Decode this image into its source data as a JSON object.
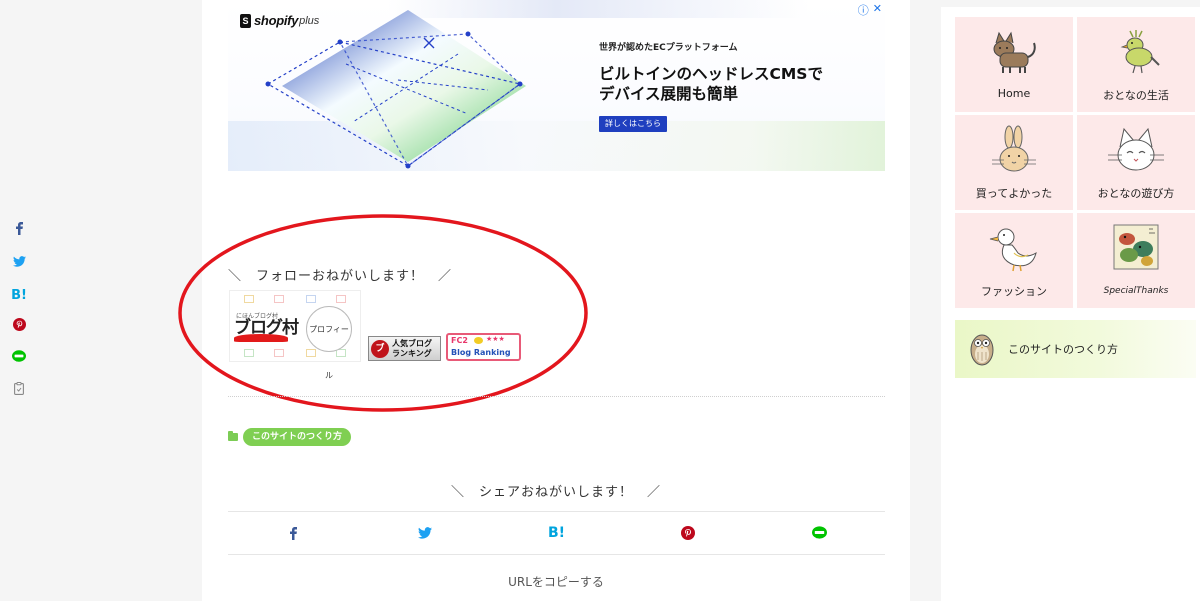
{
  "side_share": {
    "icons": [
      "facebook-icon",
      "twitter-icon",
      "hatena-bookmark-icon",
      "pinterest-icon",
      "line-icon",
      "copy-icon"
    ],
    "hatena_label": "B!",
    "colors": {
      "facebook": "#3b5998",
      "twitter": "#1da1f2",
      "hatena": "#00a4de",
      "pinterest": "#bd081c",
      "line": "#00c300",
      "copy": "#888888"
    }
  },
  "ad": {
    "logo_brand": "shopify",
    "logo_plus": "plus",
    "kicker": "世界が認めたECプラットフォーム",
    "headline_line1": "ビルトインのヘッドレスCMSで",
    "headline_line2": "デバイス展開も簡単",
    "cta": "詳しくはこちら",
    "info_icon": "ⓘ",
    "close_icon": "✕"
  },
  "follow": {
    "heading_left": "＼",
    "heading": "フォローおねがいします！",
    "heading_right": "／",
    "blogmura": {
      "small": "にほんブログ村",
      "main": "ブログ村",
      "circle": "プロフィール"
    },
    "ninki": {
      "line1": "人気ブログ",
      "line2": "ランキング"
    },
    "fc2": {
      "line1": "FC2",
      "stars": "★★★",
      "line2": "Blog Ranking"
    }
  },
  "category": {
    "label": "このサイトのつくり方",
    "accent": "#7fcf52"
  },
  "share": {
    "heading_left": "＼",
    "heading": "シェアおねがいします！",
    "heading_right": "／",
    "hatena_label": "B!",
    "copy_url": "URLをコピーする"
  },
  "sidebar": {
    "menu": [
      {
        "label": "Home",
        "icon": "cat-icon"
      },
      {
        "label": "おとなの生活",
        "icon": "bird-icon"
      },
      {
        "label": "買ってよかった",
        "icon": "rabbit-icon"
      },
      {
        "label": "おとなの遊び方",
        "icon": "cat-face-icon"
      },
      {
        "label": "ファッション",
        "icon": "duck-icon"
      },
      {
        "label": "SpecialThanks",
        "icon": "birds-painting-icon"
      }
    ],
    "howto": {
      "label": "このサイトのつくり方",
      "icon": "owl-icon"
    }
  }
}
